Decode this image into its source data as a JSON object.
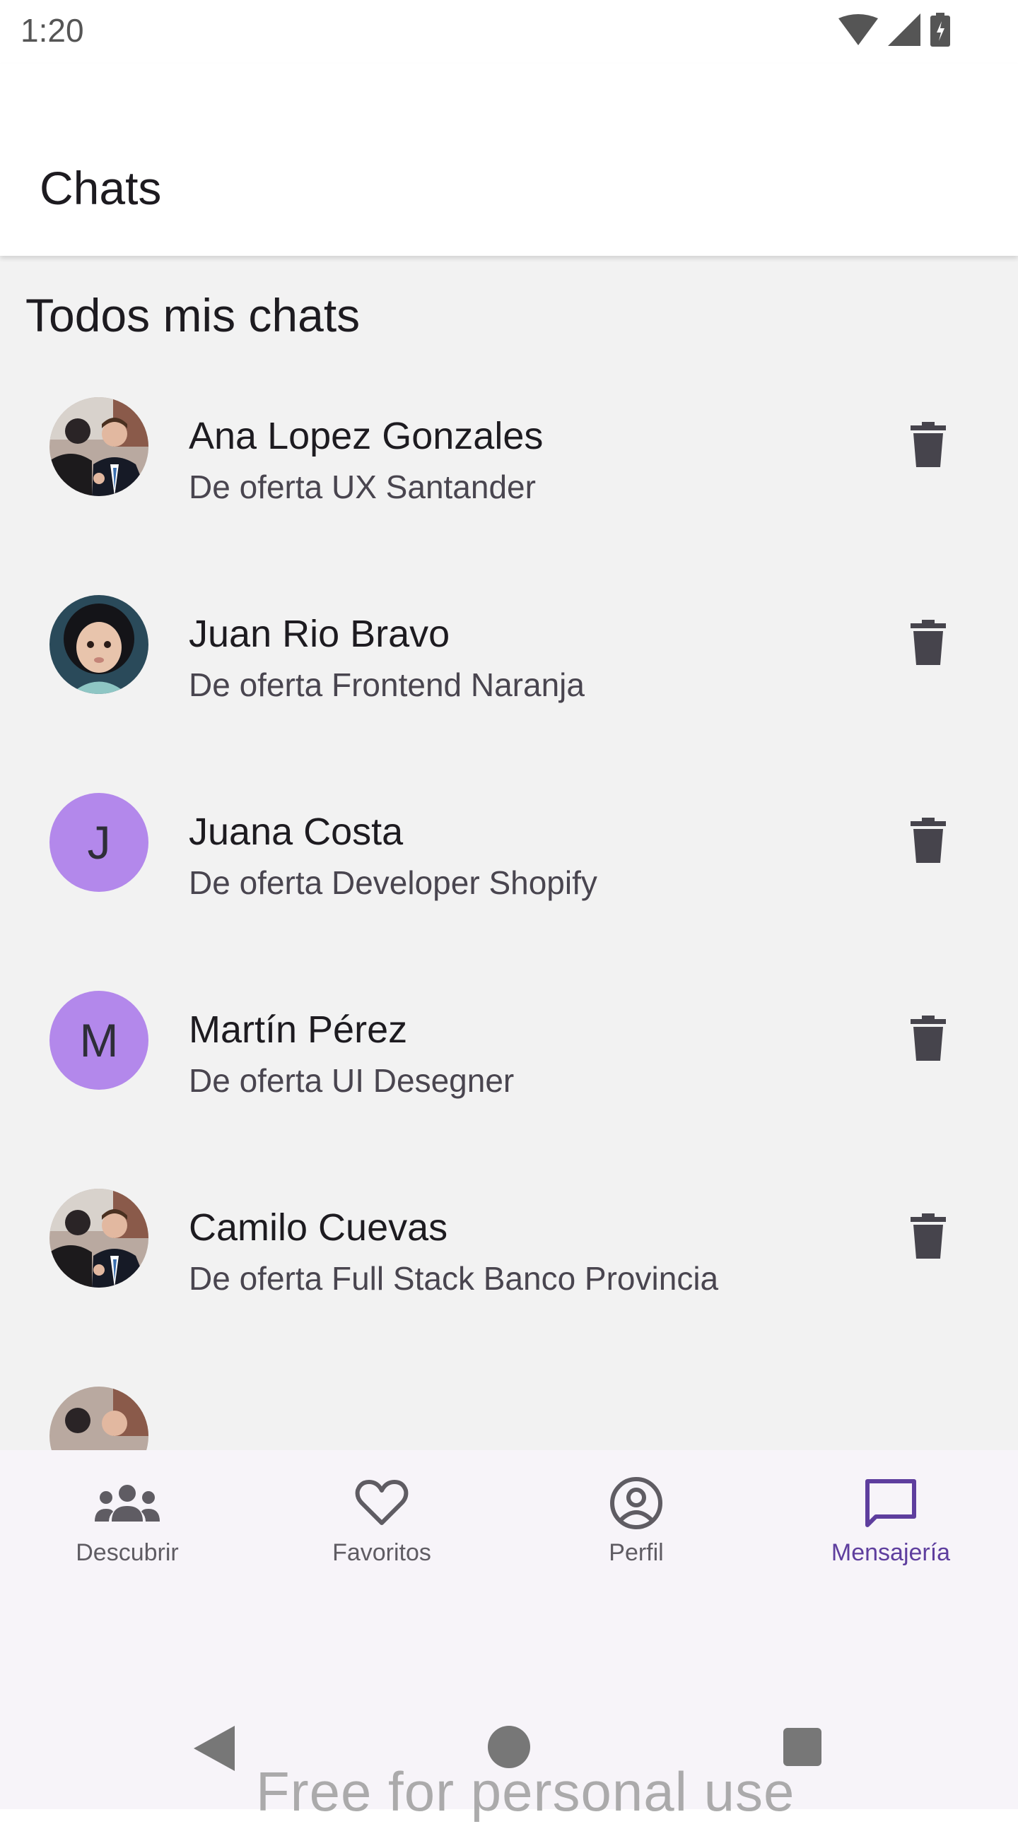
{
  "status_bar": {
    "time": "1:20"
  },
  "app_bar": {
    "title": "Chats"
  },
  "section": {
    "title": "Todos mis chats"
  },
  "chats": [
    {
      "name": "Ana Lopez Gonzales",
      "subtitle": "De oferta UX Santander",
      "avatar": "photo-couple"
    },
    {
      "name": "Juan Rio Bravo",
      "subtitle": "De oferta Frontend Naranja",
      "avatar": "photo-child"
    },
    {
      "name": "Juana Costa",
      "subtitle": "De oferta Developer Shopify",
      "avatar_letter": "J"
    },
    {
      "name": "Martín Pérez",
      "subtitle": "De oferta UI Desegner",
      "avatar_letter": "M"
    },
    {
      "name": "Camilo Cuevas",
      "subtitle": "De oferta Full Stack Banco Provincia",
      "avatar": "photo-couple"
    }
  ],
  "bottom_nav": {
    "items": [
      {
        "label": "Descubrir",
        "icon": "group-icon"
      },
      {
        "label": "Favoritos",
        "icon": "heart-icon"
      },
      {
        "label": "Perfil",
        "icon": "account-circle-icon"
      },
      {
        "label": "Mensajería",
        "icon": "chat-bubble-icon"
      }
    ],
    "active_label": "Mensajería"
  },
  "watermark": "Free for personal use",
  "colors": {
    "accent": "#5e3e9e",
    "avatar_letter_bg": "#b388eb",
    "content_bg": "#f2f2f2"
  }
}
